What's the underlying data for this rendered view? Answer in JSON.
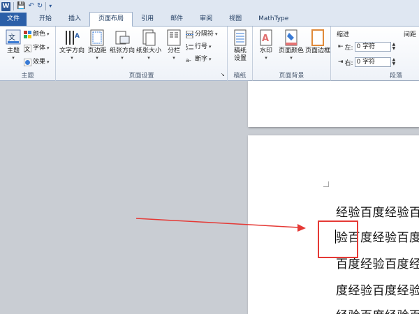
{
  "qat": {
    "logo": "W",
    "undo_icon": "undo-icon",
    "redo_icon": "redo-icon"
  },
  "tabs": [
    "文件",
    "开始",
    "插入",
    "页面布局",
    "引用",
    "邮件",
    "审阅",
    "视图",
    "MathType"
  ],
  "ribbon": {
    "theme": {
      "label": "主题",
      "button": "主题",
      "colors": "颜色",
      "fonts": "字体",
      "effects": "效果"
    },
    "page_setup": {
      "label": "页面设置",
      "text_direction": "文字方向",
      "margins": "页边距",
      "orientation": "纸张方向",
      "size": "纸张大小",
      "columns": "分栏",
      "breaks": "分隔符",
      "line_numbers": "行号",
      "hyphenation": "断字"
    },
    "draft": {
      "label": "稿纸",
      "button": "稿纸\n设置"
    },
    "page_background": {
      "label": "页面背景",
      "watermark": "水印",
      "page_color": "页面颜色",
      "page_borders": "页面边框"
    },
    "paragraph": {
      "label": "段落",
      "indent_header": "缩进",
      "spacing_header": "间距",
      "left_label": "左:",
      "right_label": "右:",
      "left_value": "0 字符",
      "right_value": "0 字符"
    }
  },
  "document": {
    "lines": [
      "经验百度经验百",
      "验百度经验百度",
      "百度经验百度经",
      "度经验百度经验",
      "经验百度经验百"
    ]
  },
  "colors": {
    "accent": "#2b5fa8",
    "annotation": "#e53935"
  }
}
